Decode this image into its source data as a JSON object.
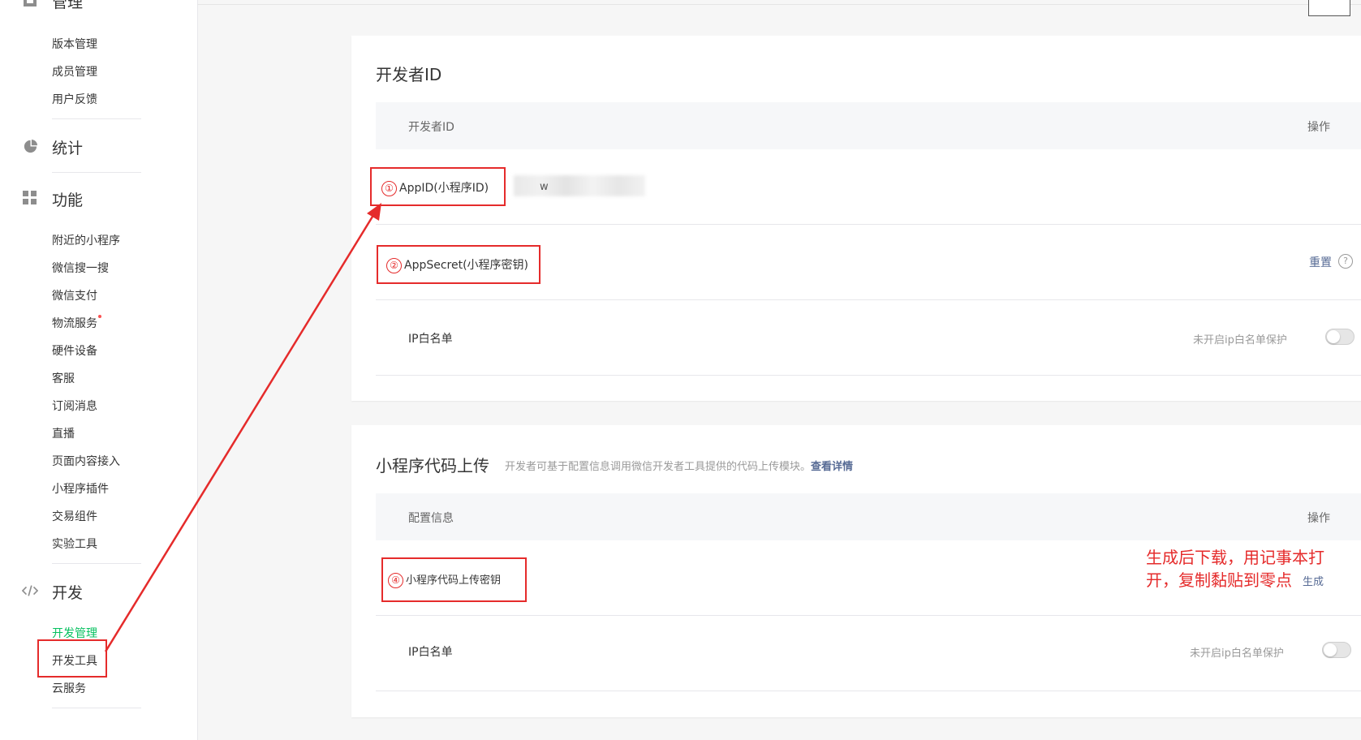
{
  "sidebar": {
    "top_partial_label": "管理",
    "manage_items": [
      "版本管理",
      "成员管理",
      "用户反馈"
    ],
    "groups": {
      "stats": {
        "label": "统计",
        "icon": "pie-chart-icon"
      },
      "features": {
        "label": "功能",
        "icon": "grid-icon"
      },
      "dev": {
        "label": "开发",
        "icon": "code-icon"
      }
    },
    "feature_items": [
      "附近的小程序",
      "微信搜一搜",
      "微信支付",
      "物流服务",
      "硬件设备",
      "客服",
      "订阅消息",
      "直播",
      "页面内容接入",
      "小程序插件",
      "交易组件",
      "实验工具"
    ],
    "dev_items": [
      "开发管理",
      "开发工具",
      "云服务"
    ],
    "active_item": "开发管理"
  },
  "developer_id": {
    "title": "开发者ID",
    "header": {
      "col_name": "开发者ID",
      "col_action": "操作"
    },
    "rows": {
      "appid": {
        "number": "①",
        "label": "AppID(小程序ID)",
        "value_prefix": "w"
      },
      "appsecret": {
        "number": "②",
        "label": "AppSecret(小程序密钥)",
        "action": "重置",
        "help": "?"
      },
      "ip_whitelist": {
        "label": "IP白名单",
        "status": "未开启ip白名单保护",
        "enabled": false
      }
    }
  },
  "code_upload": {
    "title": "小程序代码上传",
    "description": "开发者可基于配置信息调用微信开发者工具提供的代码上传模块。",
    "detail_link": "查看详情",
    "header": {
      "col_name": "配置信息",
      "col_action": "操作"
    },
    "rows": {
      "upload_key": {
        "number": "④",
        "label": "小程序代码上传密钥",
        "action": "生成"
      },
      "ip_whitelist": {
        "label": "IP白名单",
        "status": "未开启ip白名单保护",
        "enabled": false
      }
    }
  },
  "annotation_note": "生成后下载，用记事本打开，复制黏贴到零点",
  "colors": {
    "active_green": "#07c160",
    "link_blue": "#576b95",
    "annotation_red": "#e52b2b"
  }
}
